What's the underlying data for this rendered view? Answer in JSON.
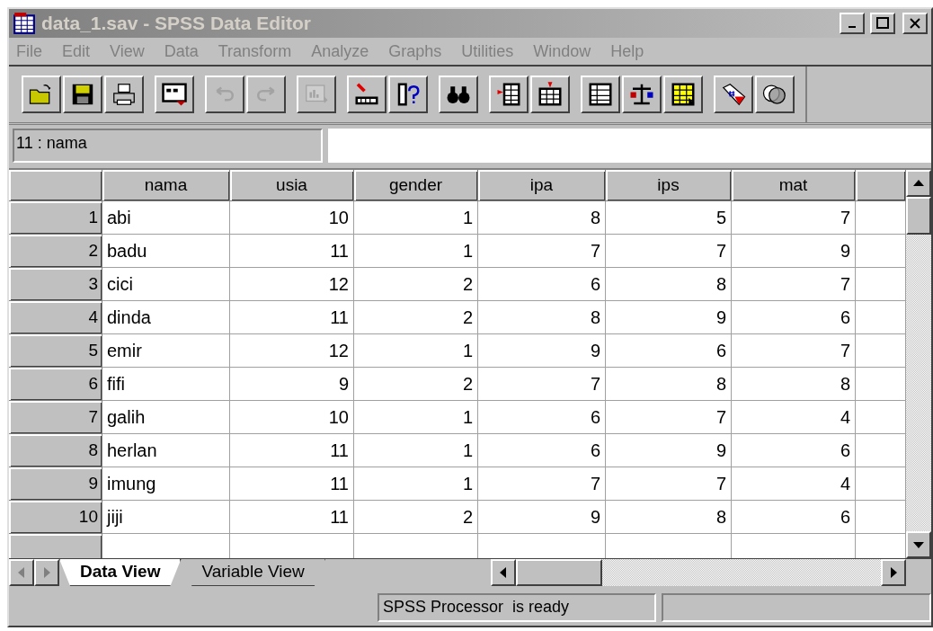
{
  "window": {
    "title": "data_1.sav - SPSS Data Editor"
  },
  "menu": [
    "File",
    "Edit",
    "View",
    "Data",
    "Transform",
    "Analyze",
    "Graphs",
    "Utilities",
    "Window",
    "Help"
  ],
  "toolbar": [
    [
      {
        "kind": "open",
        "disabled": false
      },
      {
        "kind": "save",
        "disabled": false
      },
      {
        "kind": "print",
        "disabled": false
      }
    ],
    [
      {
        "kind": "dialog",
        "disabled": false
      }
    ],
    [
      {
        "kind": "undo",
        "disabled": true
      },
      {
        "kind": "redo",
        "disabled": true
      }
    ],
    [
      {
        "kind": "chart",
        "disabled": true
      }
    ],
    [
      {
        "kind": "goto",
        "disabled": false
      },
      {
        "kind": "variables",
        "disabled": false
      }
    ],
    [
      {
        "kind": "find",
        "disabled": false
      }
    ],
    [
      {
        "kind": "insert-case",
        "disabled": false
      },
      {
        "kind": "insert-variable",
        "disabled": false
      }
    ],
    [
      {
        "kind": "split",
        "disabled": false
      },
      {
        "kind": "weight",
        "disabled": false
      },
      {
        "kind": "select",
        "disabled": false
      }
    ],
    [
      {
        "kind": "labels",
        "disabled": false
      },
      {
        "kind": "sets",
        "disabled": false
      }
    ]
  ],
  "cell_editor": {
    "reference": "11 : nama"
  },
  "table": {
    "columns": [
      {
        "name": "nama",
        "kind": "string"
      },
      {
        "name": "usia",
        "kind": "numeric"
      },
      {
        "name": "gender",
        "kind": "numeric"
      },
      {
        "name": "ipa",
        "kind": "numeric"
      },
      {
        "name": "ips",
        "kind": "numeric"
      },
      {
        "name": "mat",
        "kind": "numeric"
      }
    ],
    "rows": [
      {
        "case": "1",
        "values": [
          "abi",
          "10",
          "1",
          "8",
          "5",
          "7"
        ]
      },
      {
        "case": "2",
        "values": [
          "badu",
          "11",
          "1",
          "7",
          "7",
          "9"
        ]
      },
      {
        "case": "3",
        "values": [
          "cici",
          "12",
          "2",
          "6",
          "8",
          "7"
        ]
      },
      {
        "case": "4",
        "values": [
          "dinda",
          "11",
          "2",
          "8",
          "9",
          "6"
        ]
      },
      {
        "case": "5",
        "values": [
          "emir",
          "12",
          "1",
          "9",
          "6",
          "7"
        ]
      },
      {
        "case": "6",
        "values": [
          "fifi",
          "9",
          "2",
          "7",
          "8",
          "8"
        ]
      },
      {
        "case": "7",
        "values": [
          "galih",
          "10",
          "1",
          "6",
          "7",
          "4"
        ]
      },
      {
        "case": "8",
        "values": [
          "herlan",
          "11",
          "1",
          "6",
          "9",
          "6"
        ]
      },
      {
        "case": "9",
        "values": [
          "imung",
          "11",
          "1",
          "7",
          "7",
          "4"
        ]
      },
      {
        "case": "10",
        "values": [
          "jiji",
          "11",
          "2",
          "9",
          "8",
          "6"
        ]
      }
    ]
  },
  "tabs": [
    {
      "label": "Data View",
      "selected": true
    },
    {
      "label": "Variable View",
      "selected": false
    }
  ],
  "status_bar": {
    "message": "SPSS Processor  is ready"
  }
}
